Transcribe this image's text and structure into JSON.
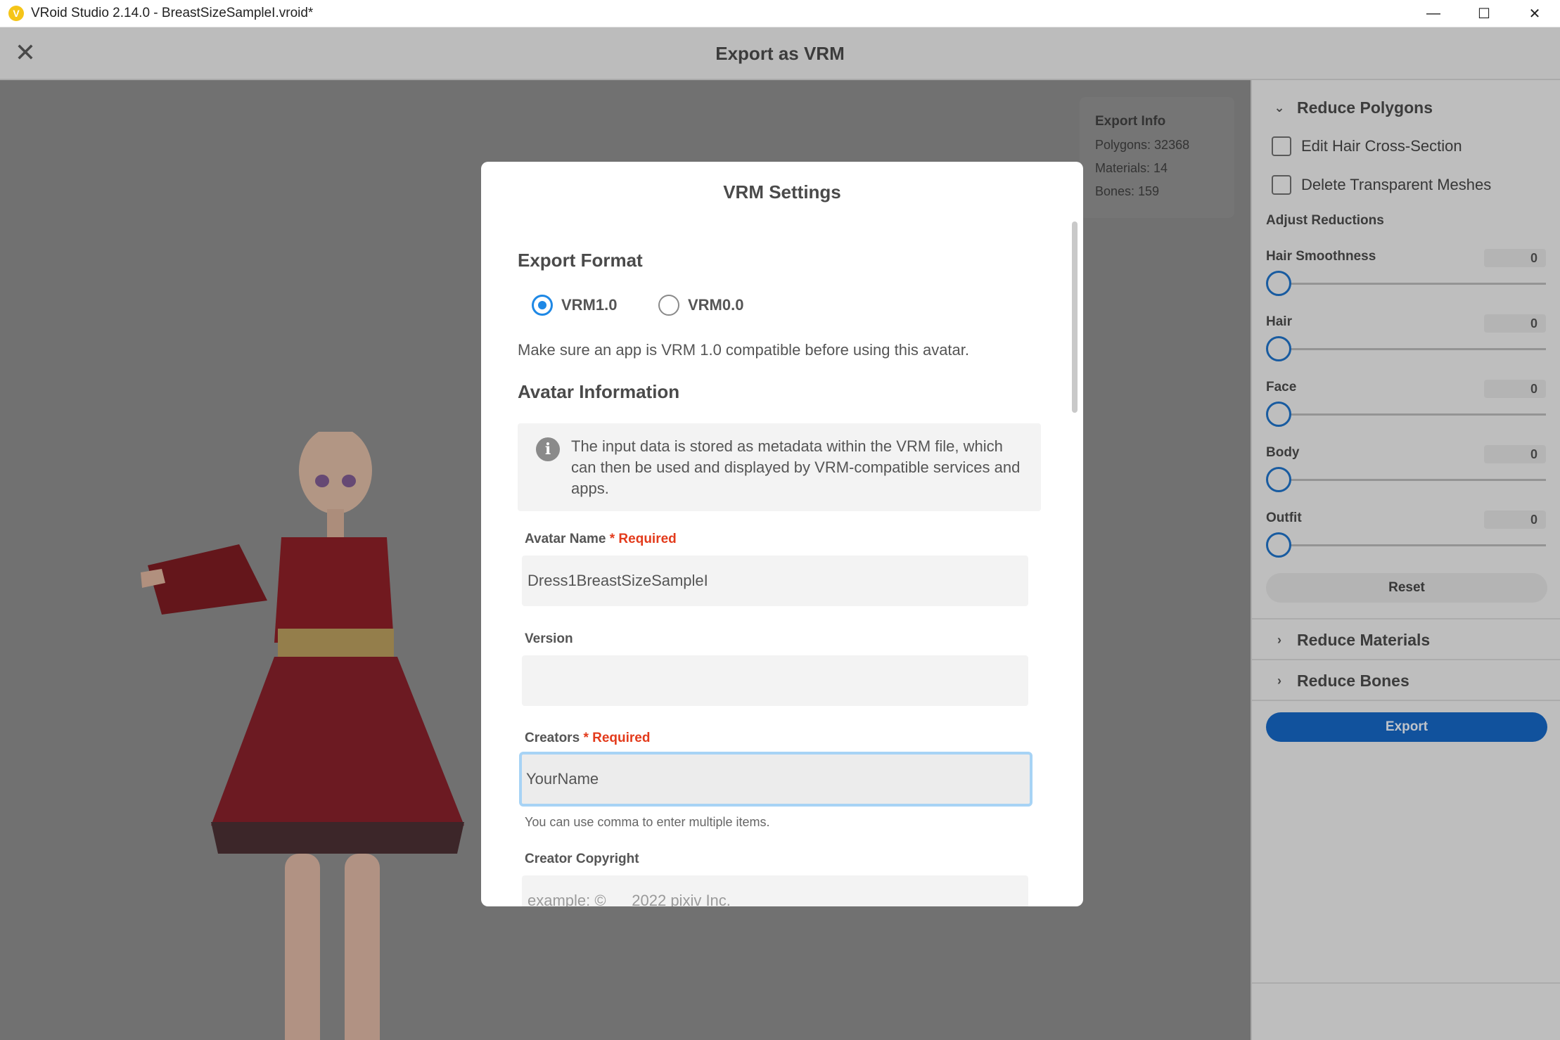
{
  "window": {
    "logo_glyph": "V",
    "title": "VRoid Studio 2.14.0 - BreastSizeSampleI.vroid*",
    "controls": {
      "minimize": "—",
      "maximize": "☐",
      "close": "✕"
    }
  },
  "header": {
    "close_glyph": "✕",
    "title": "Export as VRM"
  },
  "export_info": {
    "title": "Export Info",
    "polygons": "Polygons: 32368",
    "materials": "Materials: 14",
    "bones": "Bones: 159"
  },
  "right_panel": {
    "reduce_polygons": {
      "label": "Reduce Polygons",
      "expanded": true
    },
    "checkboxes": [
      {
        "label": "Edit Hair Cross-Section",
        "checked": false
      },
      {
        "label": "Delete Transparent Meshes",
        "checked": false
      }
    ],
    "adjust_reductions": "Adjust Reductions",
    "sliders": [
      {
        "label": "Hair Smoothness",
        "value": "0"
      },
      {
        "label": "Hair",
        "value": "0"
      },
      {
        "label": "Face",
        "value": "0"
      },
      {
        "label": "Body",
        "value": "0"
      },
      {
        "label": "Outfit",
        "value": "0"
      }
    ],
    "reset_label": "Reset",
    "reduce_materials": {
      "label": "Reduce Materials",
      "expanded": false
    },
    "reduce_bones": {
      "label": "Reduce Bones",
      "expanded": false
    },
    "export_label": "Export",
    "chevron_down": "⌄",
    "chevron_right": "›"
  },
  "modal": {
    "title": "VRM Settings",
    "export_format": {
      "heading": "Export Format",
      "options": [
        {
          "label": "VRM1.0",
          "selected": true
        },
        {
          "label": "VRM0.0",
          "selected": false
        }
      ],
      "note": "Make sure an app is VRM 1.0 compatible before using this avatar."
    },
    "avatar_information": {
      "heading": "Avatar Information",
      "info_icon_glyph": "i",
      "info_text": "The input data is stored as metadata within the VRM file, which can then be used and displayed by VRM-compatible services and apps."
    },
    "fields": {
      "avatar_name": {
        "label": "Avatar Name",
        "required": "* Required",
        "value": "Dress1BreastSizeSampleI"
      },
      "version": {
        "label": "Version",
        "value": ""
      },
      "creators": {
        "label": "Creators",
        "required": "* Required",
        "value": "YourName",
        "hint": "You can use comma to enter multiple items."
      },
      "creator_copyright": {
        "label": "Creator Copyright",
        "placeholder": "example: ©      2022 pixiv Inc."
      }
    }
  },
  "colors": {
    "accent": "#1e88e5",
    "export_button": "#1565c0",
    "required": "#e33b1c",
    "viewport_bg": "#8a8a8a"
  }
}
